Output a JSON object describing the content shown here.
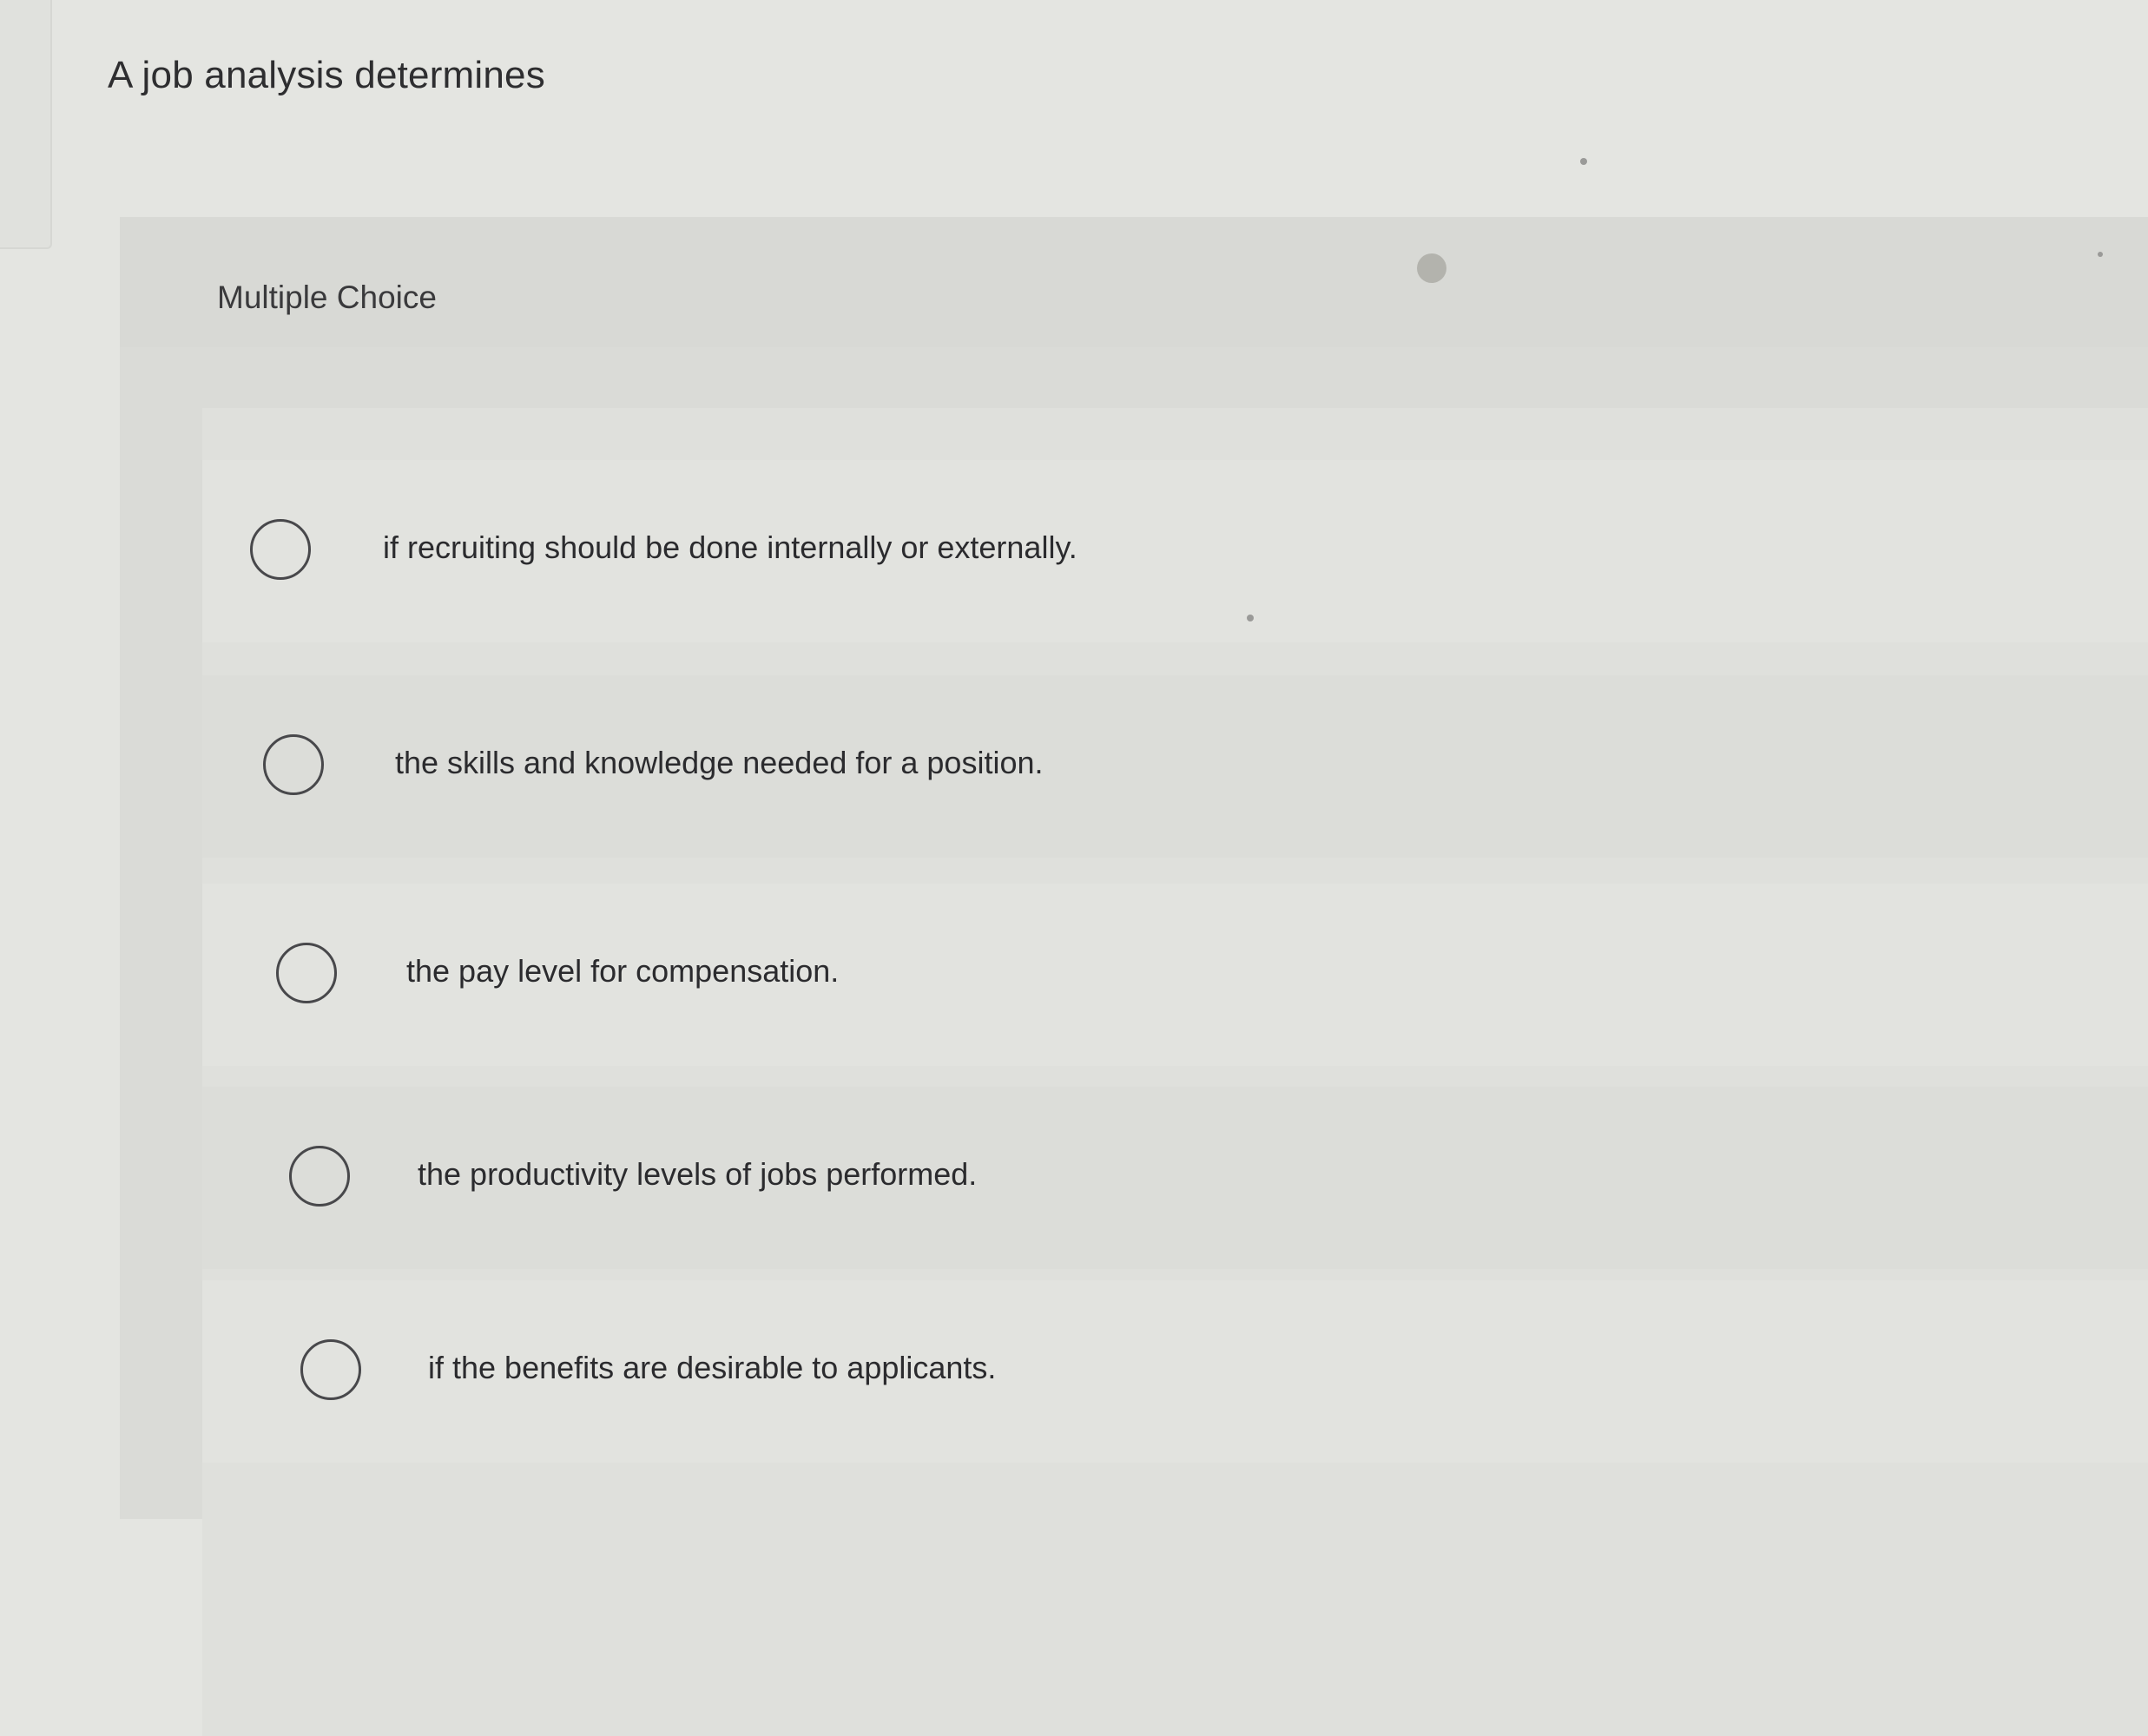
{
  "question": {
    "text": "A job analysis determines"
  },
  "question_type": "Multiple Choice",
  "options": [
    {
      "label": "if recruiting should be done internally or externally.",
      "selected": false
    },
    {
      "label": "the skills and knowledge needed for a position.",
      "selected": false
    },
    {
      "label": "the pay level for compensation.",
      "selected": false
    },
    {
      "label": "the productivity levels of jobs performed.",
      "selected": false
    },
    {
      "label": "if the benefits are desirable to applicants.",
      "selected": false
    }
  ]
}
